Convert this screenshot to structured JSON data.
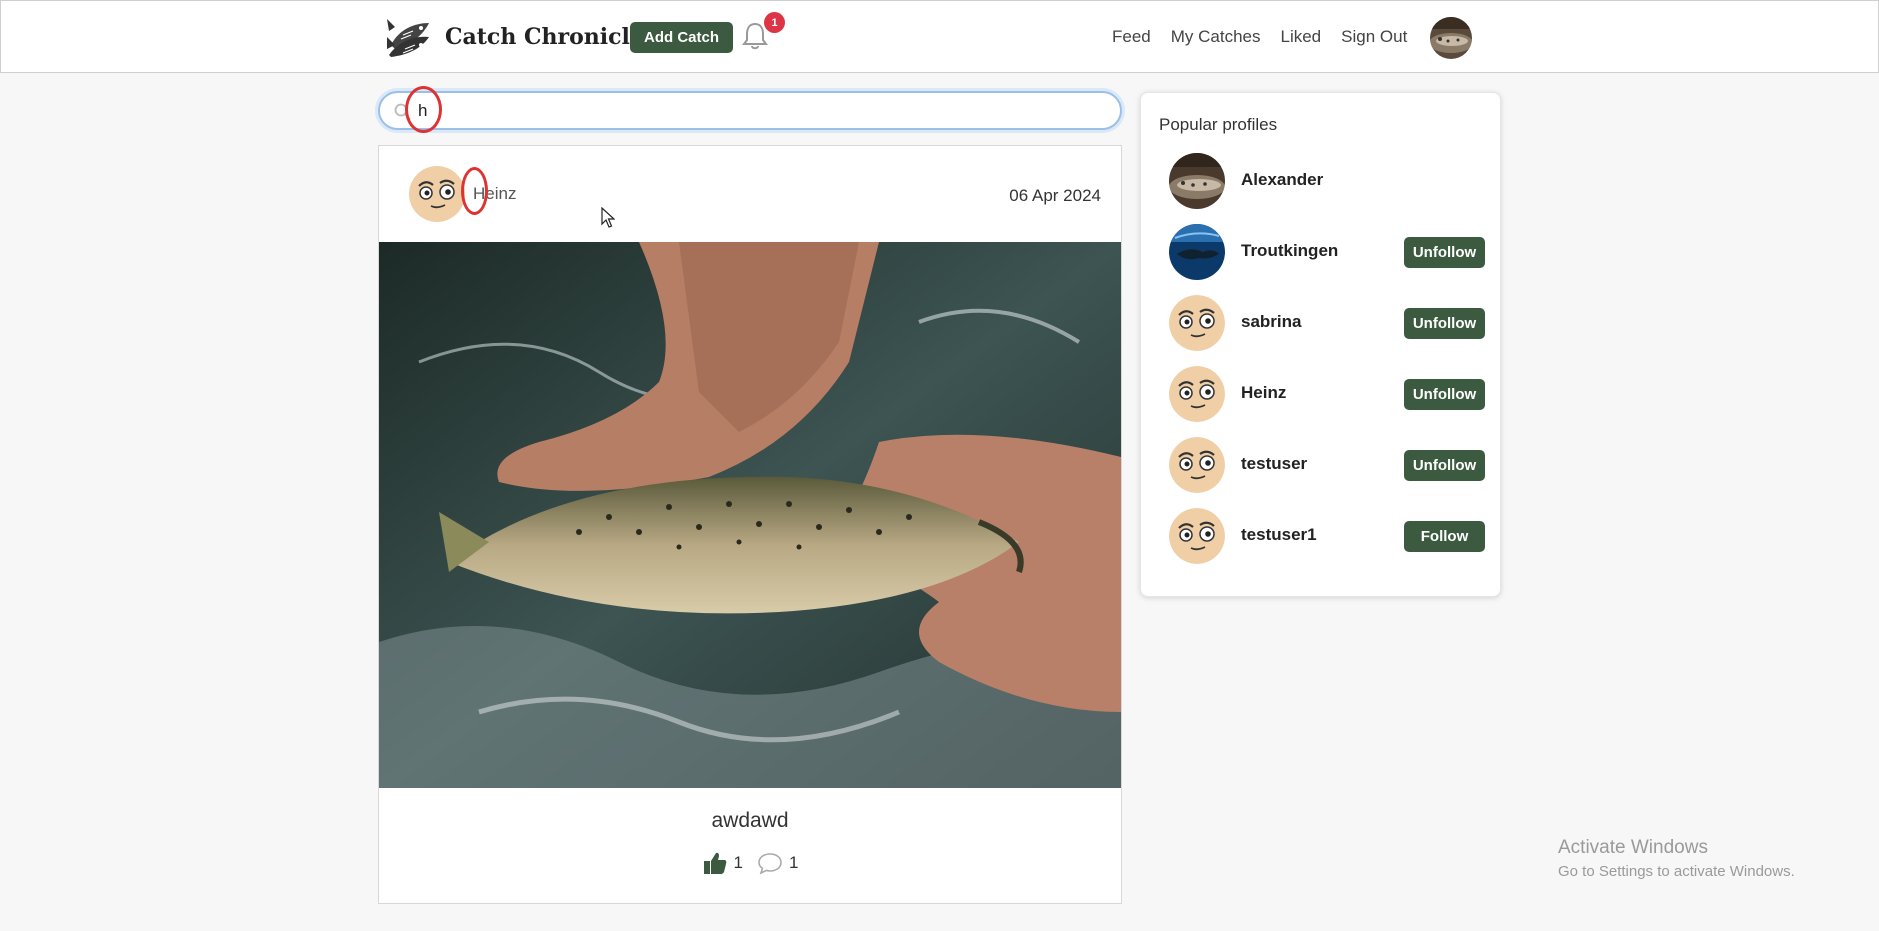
{
  "navbar": {
    "brand": "Catch Chronicle",
    "add_catch_label": "Add Catch",
    "notification_count": "1",
    "links": [
      "Feed",
      "My Catches",
      "Liked",
      "Sign Out"
    ]
  },
  "search": {
    "value": "h",
    "placeholder": ""
  },
  "post": {
    "owner": "Heinz",
    "date": "06 Apr 2024",
    "title": "awdawd",
    "likes": "1",
    "comments": "1"
  },
  "popular": {
    "title": "Popular profiles",
    "profiles": [
      {
        "name": "Alexander",
        "button": ""
      },
      {
        "name": "Troutkingen",
        "button": "Unfollow"
      },
      {
        "name": "sabrina",
        "button": "Unfollow"
      },
      {
        "name": "Heinz",
        "button": "Unfollow"
      },
      {
        "name": "testuser",
        "button": "Unfollow"
      },
      {
        "name": "testuser1",
        "button": "Follow"
      }
    ]
  },
  "watermark": {
    "line1": "Activate Windows",
    "line2": "Go to Settings to activate Windows."
  },
  "colors": {
    "accent_green": "#3b5a3f",
    "badge_red": "#dc3545",
    "annotation_red": "#dd3333"
  },
  "icons": [
    "fish-logo-icon",
    "bell-icon",
    "search-icon",
    "thumbs-up-icon",
    "comment-icon",
    "cursor-icon"
  ]
}
